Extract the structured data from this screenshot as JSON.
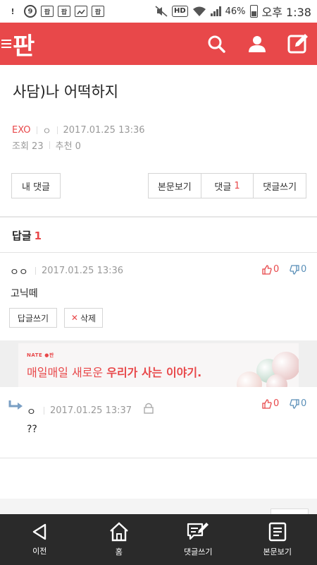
{
  "status_bar": {
    "icons": [
      "9",
      "팝",
      "팝",
      "image-icon",
      "팝"
    ],
    "hd": "HD",
    "battery_pct": "46%",
    "time": "오후 1:38"
  },
  "app": {
    "logo": "판",
    "accent": "#e8484a"
  },
  "post": {
    "title": "사담)나 어떡하지",
    "category": "EXO",
    "author": "ㅇ",
    "date": "2017.01.25 13:36",
    "views_label": "조회 23",
    "recommend_label": "추천 0"
  },
  "actions": {
    "my_comments": "내 댓글",
    "view_post": "본문보기",
    "comments": "댓글",
    "comments_count": "1",
    "write_comment": "댓글쓰기"
  },
  "replies": {
    "header": "답글",
    "count": "1"
  },
  "comments": [
    {
      "author": "ㅇㅇ",
      "date": "2017.01.25 13:36",
      "text": "고닉떼",
      "up": "0",
      "down": "0",
      "reply_btn": "답글쓰기",
      "delete_btn": "삭제"
    },
    {
      "author": "ㅇ",
      "date": "2017.01.25 13:37",
      "text": "??",
      "up": "0",
      "down": "0"
    }
  ],
  "ad": {
    "brand": "NATE ●판",
    "text_plain": "매일매일 새로운 ",
    "text_bold": "우리가 사는 이야기."
  },
  "bottom_nav": [
    {
      "label": "이전",
      "icon": "back-icon"
    },
    {
      "label": "홈",
      "icon": "home-icon"
    },
    {
      "label": "댓글쓰기",
      "icon": "comment-write-icon"
    },
    {
      "label": "본문보기",
      "icon": "document-icon"
    }
  ]
}
